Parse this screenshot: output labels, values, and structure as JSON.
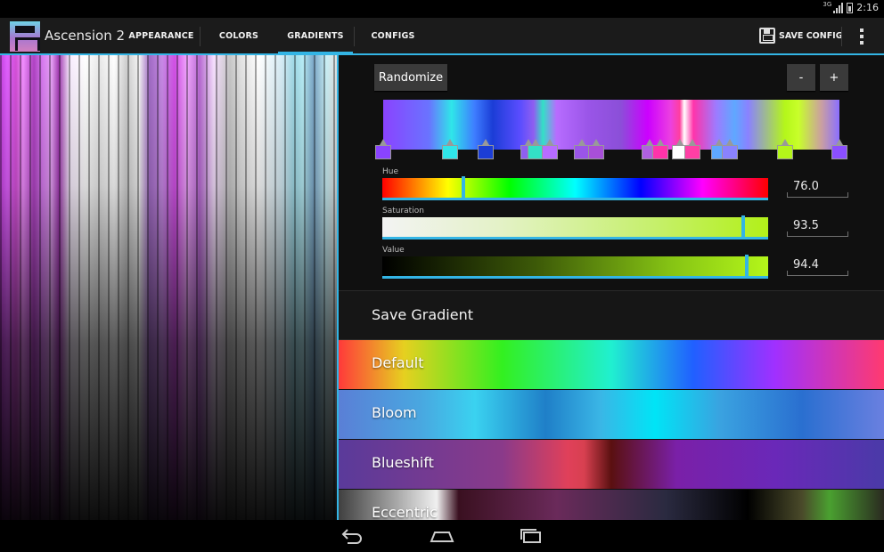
{
  "status_bar": {
    "network": "3G",
    "time": "2:16"
  },
  "action_bar": {
    "app_title": "Ascension 2",
    "tabs": [
      {
        "label": "APPEARANCE",
        "active": false
      },
      {
        "label": "COLORS",
        "active": false
      },
      {
        "label": "GRADIENTS",
        "active": true
      },
      {
        "label": "CONFIGS",
        "active": false
      }
    ],
    "save_config_label": "SAVE CONFIG",
    "accent_color": "#33b5e5"
  },
  "editor": {
    "randomize_label": "Randomize",
    "minus_label": "-",
    "plus_label": "+",
    "gradient_stops": [
      {
        "color": "#8a43ff"
      },
      {
        "color": "#2fe6e9"
      },
      {
        "color": "#1b3dd6"
      },
      {
        "color": "#8f5ff0"
      },
      {
        "color": "#33e0c6"
      },
      {
        "color": "#b76cff"
      },
      {
        "color": "#9a55e8"
      },
      {
        "color": "#a84fd8"
      },
      {
        "color": "#b060e0"
      },
      {
        "color": "#ff33aa"
      },
      {
        "color": "#ffffff"
      },
      {
        "color": "#ff3fa5"
      },
      {
        "color": "#5fa8ff"
      },
      {
        "color": "#8a82ff"
      },
      {
        "color": "#b4f61a"
      },
      {
        "color": "#8b4fff"
      }
    ],
    "hue": {
      "label": "Hue",
      "value": "76.0",
      "fraction": 0.211
    },
    "saturation": {
      "label": "Saturation",
      "value": "93.5",
      "fraction": 0.935
    },
    "value": {
      "label": "Value",
      "value": "94.4",
      "fraction": 0.944
    }
  },
  "save_gradient_label": "Save Gradient",
  "gradients": [
    {
      "name": "Default"
    },
    {
      "name": "Bloom"
    },
    {
      "name": "Blueshift"
    },
    {
      "name": "Eccentric"
    }
  ]
}
